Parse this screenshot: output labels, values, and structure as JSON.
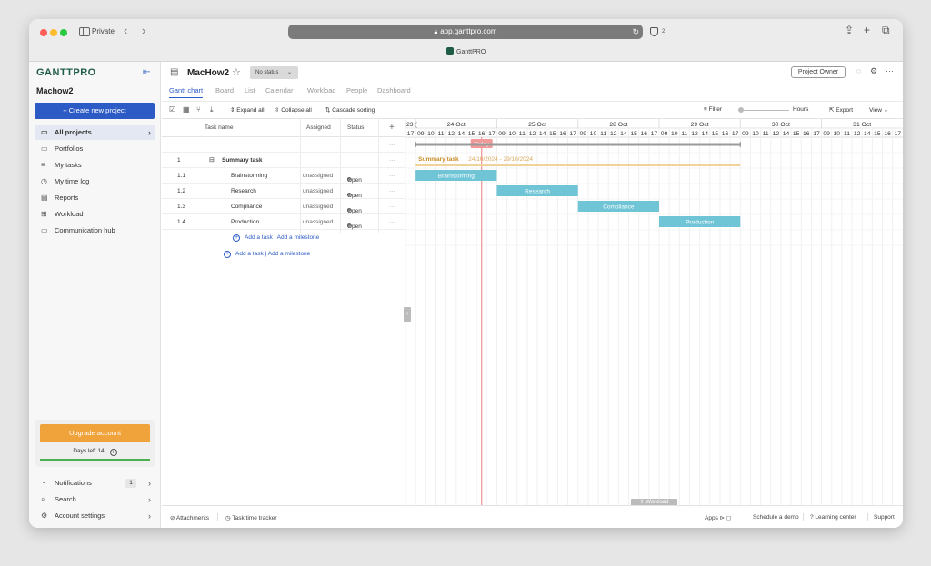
{
  "browser": {
    "private_label": "Private",
    "url": "app.ganttpro.com",
    "tab_title": "GanttPRO",
    "shield_count": "2"
  },
  "sidebar": {
    "logo": "GANTTPRO",
    "workspace": "Machow2",
    "create_button": "+ Create new project",
    "items": [
      {
        "label": "All projects",
        "icon": "folder-icon"
      },
      {
        "label": "Portfolios",
        "icon": "briefcase-icon"
      },
      {
        "label": "My tasks",
        "icon": "list-icon"
      },
      {
        "label": "My time log",
        "icon": "clock-icon"
      },
      {
        "label": "Reports",
        "icon": "report-icon"
      },
      {
        "label": "Workload",
        "icon": "grid-icon"
      },
      {
        "label": "Communication hub",
        "icon": "chat-icon"
      }
    ],
    "upgrade_button": "Upgrade account",
    "days_left": "Days left 14",
    "bottom_items": [
      {
        "label": "Notifications",
        "badge": "1"
      },
      {
        "label": "Search"
      },
      {
        "label": "Account settings"
      }
    ]
  },
  "project": {
    "title": "MacHow2",
    "status": "No status",
    "owner_button": "Project Owner"
  },
  "tabs": [
    "Gantt chart",
    "Board",
    "List",
    "Calendar",
    "Workload",
    "People",
    "Dashboard"
  ],
  "toolbar": {
    "expand_all": "Expand all",
    "collapse_all": "Collapse all",
    "cascade_sorting": "Cascade sorting",
    "filter": "Filter",
    "zoom_unit": "Hours",
    "export": "Export",
    "view": "View"
  },
  "grid": {
    "headers": {
      "task_name": "Task name",
      "assigned": "Assigned",
      "status": "Status",
      "add": "+"
    },
    "rows": [
      {
        "num": "",
        "name": "",
        "assigned": "",
        "status": "",
        "more": "···"
      },
      {
        "num": "1",
        "name": "Summary task",
        "assigned": "",
        "status": "",
        "more": "···"
      },
      {
        "num": "1.1",
        "name": "Brainstorming",
        "assigned": "unassigned",
        "status": "Open",
        "more": "···"
      },
      {
        "num": "1.2",
        "name": "Research",
        "assigned": "unassigned",
        "status": "Open",
        "more": "···"
      },
      {
        "num": "1.3",
        "name": "Compliance",
        "assigned": "unassigned",
        "status": "Open",
        "more": "···"
      },
      {
        "num": "1.4",
        "name": "Production",
        "assigned": "unassigned",
        "status": "Open",
        "more": "···"
      }
    ],
    "add_task": "Add a task",
    "add_milestone": "Add a milestone"
  },
  "gantt": {
    "days": [
      {
        "label": "23 (",
        "hours": [
          "17"
        ]
      },
      {
        "label": "24 Oct",
        "hours": [
          "09",
          "10",
          "11",
          "12",
          "14",
          "15",
          "16",
          "17"
        ]
      },
      {
        "label": "25 Oct",
        "hours": [
          "09",
          "10",
          "11",
          "12",
          "14",
          "15",
          "16",
          "17"
        ]
      },
      {
        "label": "28 Oct",
        "hours": [
          "09",
          "10",
          "11",
          "12",
          "14",
          "15",
          "16",
          "17"
        ]
      },
      {
        "label": "29 Oct",
        "hours": [
          "09",
          "10",
          "11",
          "12",
          "14",
          "15",
          "16",
          "17"
        ]
      },
      {
        "label": "30 Oct",
        "hours": [
          "09",
          "10",
          "11",
          "12",
          "14",
          "15",
          "16",
          "17"
        ]
      },
      {
        "label": "31 Oct",
        "hours": [
          "09",
          "10",
          "11",
          "12",
          "14",
          "15",
          "16",
          "17"
        ]
      }
    ],
    "today_label": "Today",
    "today_hour_index": 7,
    "project_bar": {
      "start": 1,
      "end": 33
    },
    "summary": {
      "label": "Summary task",
      "dates": "24/10/2024 - 29/10/2024",
      "start": 1,
      "end": 33,
      "color": "#f0d39a"
    },
    "tasks": [
      {
        "name": "Brainstorming",
        "start": 1,
        "end": 9,
        "row": 2
      },
      {
        "name": "Research",
        "start": 9,
        "end": 17,
        "row": 3
      },
      {
        "name": "Compliance",
        "start": 17,
        "end": 25,
        "row": 4
      },
      {
        "name": "Production",
        "start": 25,
        "end": 33,
        "row": 5
      }
    ],
    "bar_color": "#6fc4d6",
    "today_color": "#f29a9a",
    "workload_tab": "Workload"
  },
  "bottombar": {
    "attachments": "Attachments",
    "time_tracker": "Task time tracker",
    "apps": "Apps",
    "schedule_demo": "Schedule a demo",
    "learning_center": "Learning center",
    "support": "Support"
  }
}
